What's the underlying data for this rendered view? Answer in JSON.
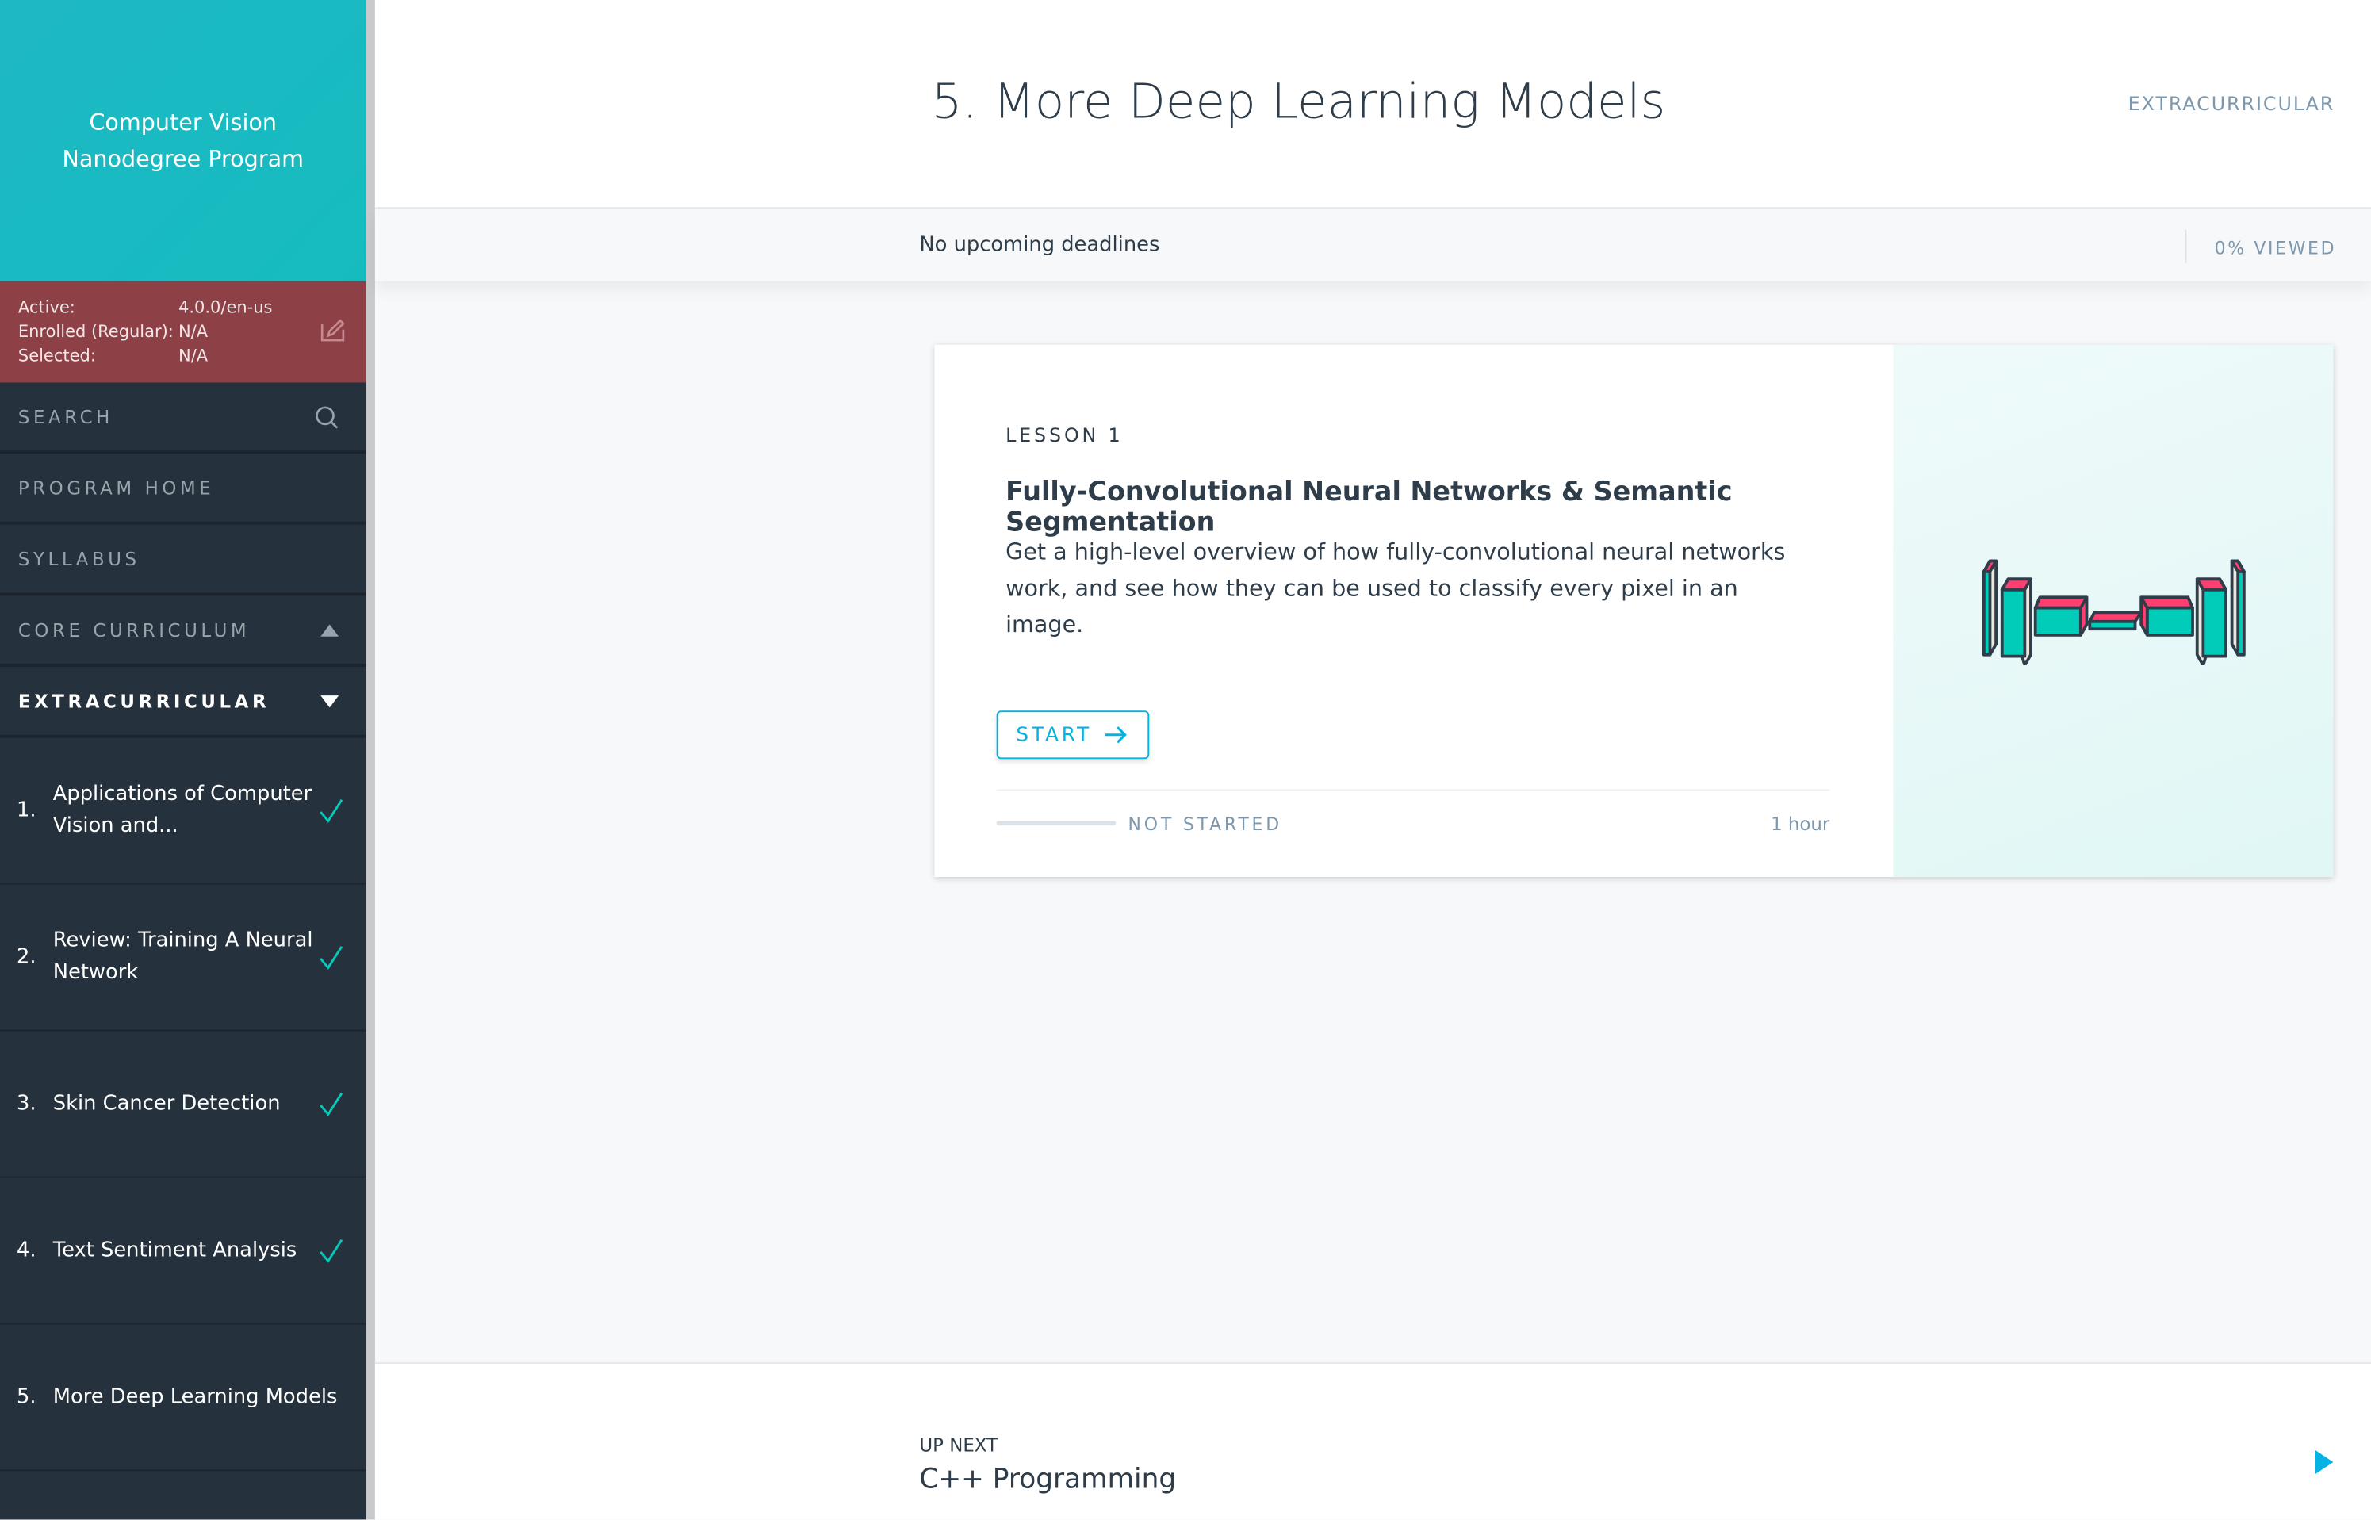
{
  "sidebar": {
    "program_title_line1": "Computer Vision",
    "program_title_line2": "Nanodegree Program",
    "env": [
      {
        "key": "Active:",
        "value": "4.0.0/en-us"
      },
      {
        "key": "Enrolled (Regular):",
        "value": "N/A"
      },
      {
        "key": "Selected:",
        "value": "N/A"
      }
    ],
    "search": "SEARCH",
    "program_home": "PROGRAM HOME",
    "syllabus": "SYLLABUS",
    "core": "CORE CURRICULUM",
    "extra": "EXTRACURRICULAR",
    "lessons": [
      {
        "num": "1.",
        "title": "Applications of Computer Vision and...",
        "done": true
      },
      {
        "num": "2.",
        "title": "Review: Training A Neural Network",
        "done": true
      },
      {
        "num": "3.",
        "title": "Skin Cancer Detection",
        "done": true
      },
      {
        "num": "4.",
        "title": "Text Sentiment Analysis",
        "done": true
      },
      {
        "num": "5.",
        "title": "More Deep Learning Models",
        "done": false
      }
    ]
  },
  "header": {
    "title": "5. More Deep Learning Models",
    "tag": "EXTRACURRICULAR",
    "deadlines": "No upcoming deadlines",
    "viewed": "0% VIEWED"
  },
  "card": {
    "label": "LESSON 1",
    "title": "Fully-Convolutional Neural Networks & Semantic Segmentation",
    "desc": "Get a high-level overview of how fully-convolutional neural networks work, and see how they can be used to classify every pixel in an image.",
    "start": "START",
    "status": "NOT STARTED",
    "progress": 0,
    "duration": "1 hour"
  },
  "footer": {
    "up_next": "UP NEXT",
    "next_title": "C++ Programming"
  },
  "colors": {
    "accent": "#02b3e4",
    "check": "#02ccba",
    "env_bg": "#8e4047",
    "hero": "#1bb6c1"
  }
}
